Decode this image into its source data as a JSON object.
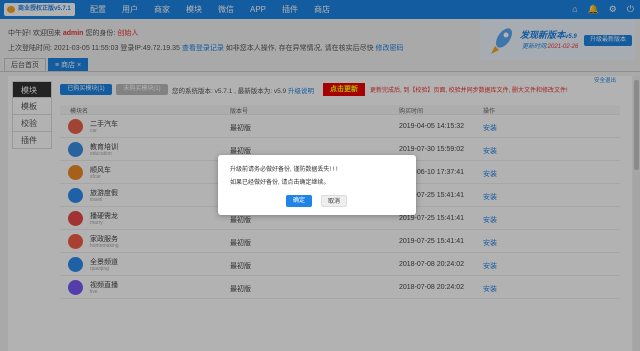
{
  "app": {
    "title": "商业授权正版v5.7.1"
  },
  "nav": [
    "配置",
    "用户",
    "商家",
    "模块",
    "微信",
    "APP",
    "插件",
    "商店"
  ],
  "toolbar_icons": [
    "home-icon",
    "bell-icon",
    "gear-icon",
    "power-icon"
  ],
  "info": {
    "greeting": "中午好! 欢迎回来",
    "username": "admin",
    "identity_label": "您的身份:",
    "identity": "创始人",
    "last_login_label": "上次登陆时间:",
    "last_login_time": "2021-03-05 11:55:03",
    "ip_label": "登录IP:49.72.19.35",
    "view_log": "查看登录记录",
    "warning": "如非您本人操作, 存在异常情况, 请在核实后尽快",
    "change_pwd": "修改密码"
  },
  "banner": {
    "title": "发现新版本",
    "version": "v5.9",
    "date_label": "更新时间:",
    "date": "2021-02-26",
    "button": "升级最新版本"
  },
  "tabs": [
    {
      "label": "后台首页"
    },
    {
      "label": "商店"
    }
  ],
  "sidebar": [
    "模块",
    "模板",
    "校验",
    "插件"
  ],
  "toolbar": {
    "bought": "已购买模块(1)",
    "not_bought": "未购买模块(1)",
    "version_text": "您的系统版本: v5.7.1 , 最新版本为: v5.9",
    "upgrade_link": "升级说明",
    "update_button": "点击更新",
    "note": "更新完成后, 到【校验】页面, 校验并同步数据库文件, 删大文件和修改文件!",
    "exit": "安全退出"
  },
  "table": {
    "headers": [
      "模块名",
      "版本号",
      "购买时间",
      "操作"
    ],
    "rows": [
      {
        "name": "二手汽车",
        "en": "car",
        "version": "最初版",
        "date": "2019-04-05 14:15:32",
        "action": "安装",
        "color": "#e8624a"
      },
      {
        "name": "教育培训",
        "en": "education",
        "version": "最初版",
        "date": "2019-07-30 15:59:02",
        "action": "安装",
        "color": "#3a8ee6"
      },
      {
        "name": "顺风车",
        "en": "sfcar",
        "version": "最初版",
        "date": "2019-06-10 17:37:41",
        "action": "安装",
        "color": "#f08a24"
      },
      {
        "name": "旅游度假",
        "en": "travel",
        "version": "最初版",
        "date": "2019-07-25 15:41:41",
        "action": "安装",
        "color": "#2d8cf0"
      },
      {
        "name": "播硬需龙",
        "en": "marry",
        "version": "最初版",
        "date": "2019-07-25 15:41:41",
        "action": "安装",
        "color": "#e84a4a"
      },
      {
        "name": "家政服务",
        "en": "homemaking",
        "version": "最初版",
        "date": "2019-07-25 15:41:41",
        "action": "安装",
        "color": "#f25d4a"
      },
      {
        "name": "全景频道",
        "en": "quanjing",
        "version": "最初版",
        "date": "2018-07-08 20:24:02",
        "action": "安装",
        "color": "#2d8cf0"
      },
      {
        "name": "视频直播",
        "en": "live",
        "version": "最初版",
        "date": "2018-07-08 20:24:02",
        "action": "安装",
        "color": "#7a5af5"
      }
    ]
  },
  "dialog": {
    "message1": "升级前请务必做好备份, 谨防数据丢失! ! !",
    "message2": "如果已经做好备份, 请点击确定继续。",
    "ok": "确定",
    "cancel": "取消"
  }
}
